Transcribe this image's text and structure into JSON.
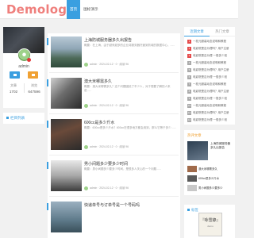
{
  "header": {
    "logo": "Demologo",
    "nav": [
      {
        "label": "首页",
        "active": true
      },
      {
        "label": "图标演示",
        "active": false
      }
    ]
  },
  "profile": {
    "name": "admin",
    "stats": [
      {
        "label": "文章",
        "value": "1702"
      },
      {
        "label": "浏览",
        "value": "647596"
      }
    ]
  },
  "categories": {
    "title": "栏目列表"
  },
  "articles": [
    {
      "title": "上海防城服务器多久出报告",
      "excerpt": "概要：在上海，由于越来越多的企业将服务器托管到防城的数据中心，......",
      "meta": "admin · 2024-02-12 · 0 · 阅读 96"
    },
    {
      "title": "澳大米哪需多久",
      "excerpt": "概要：澳大米哪需多久？这个问题困扰了不少人，对于想要了解的人来说......",
      "meta": "admin · 2024-02-12 · 0 · 阅读 96"
    },
    {
      "title": "600cc是多少斤水",
      "excerpt": "概要：600cc是多少斤水？600cc在很多地方都会用到，那么它等于多少......",
      "meta": "admin · 2024-02-12 · 0 · 阅读 96"
    },
    {
      "title": "男小间题多少要多少时间",
      "excerpt": "概要：男小间题多少要多少时间，是很多人关心的一个问题......",
      "meta": "admin · 2024-02-12 · 0 · 阅读 96"
    },
    {
      "title": "快递单号与订单号是一个号码吗",
      "excerpt": "",
      "meta": ""
    }
  ],
  "right": {
    "tabs": [
      {
        "label": "近期文章",
        "active": true
      },
      {
        "label": "热门文章",
        "active": false
      }
    ],
    "hot": [
      "一枚元服装动态说明和教程",
      "电影院是否为理吗？用户注册",
      "电影院是否为理 一般多少钱",
      "一枚元服装动态说明和教程",
      "电影院是否为理吗？用户注册",
      "电影院是否为理 一般多少钱",
      "一枚元服装动态说明和教程",
      "电影院是否为理吗？用户注册",
      "电影院是否为理 一般多少钱",
      "一枚元服装动态说明和教程",
      "电影院是否为理吗？用户注册",
      "电影院是否为理 一般多少钱"
    ],
    "recommend": {
      "title": "热评文章",
      "feature": "上海防城服务器多久出报告",
      "items": [
        "澳大米哪需多久",
        "600cc是多少斤水",
        "男小间题多少要多少"
      ]
    },
    "tags": {
      "title": "标签",
      "book_title": "『咏雪錄』",
      "book_sub": "demo"
    }
  },
  "colors": {
    "accent": "#3a9fe0",
    "logo": "#ef7f7c",
    "hot": "#e54b4b",
    "orange": "#f0a133"
  }
}
